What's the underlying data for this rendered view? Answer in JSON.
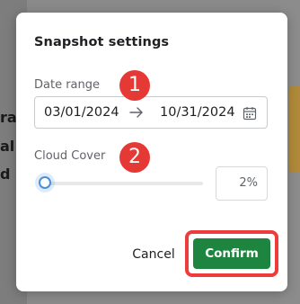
{
  "background": {
    "fragments": [
      "ra",
      "al",
      "d"
    ]
  },
  "dialog": {
    "title": "Snapshot settings",
    "date_range": {
      "label": "Date range",
      "start": "03/01/2024",
      "end": "10/31/2024",
      "arrow_icon": "arrow-right-icon",
      "calendar_icon": "calendar-icon"
    },
    "cloud_cover": {
      "label": "Cloud Cover",
      "value_text": "2%",
      "value_fraction": 0.02
    },
    "annotations": [
      "1",
      "2"
    ],
    "actions": {
      "cancel_label": "Cancel",
      "confirm_label": "Confirm"
    }
  },
  "colors": {
    "confirm_button": "#1e8540",
    "annotation_red": "#e53935",
    "highlight_border": "#ee3b3b",
    "slider_accent": "#4a90d9",
    "backdrop": "#8a8a8a"
  }
}
